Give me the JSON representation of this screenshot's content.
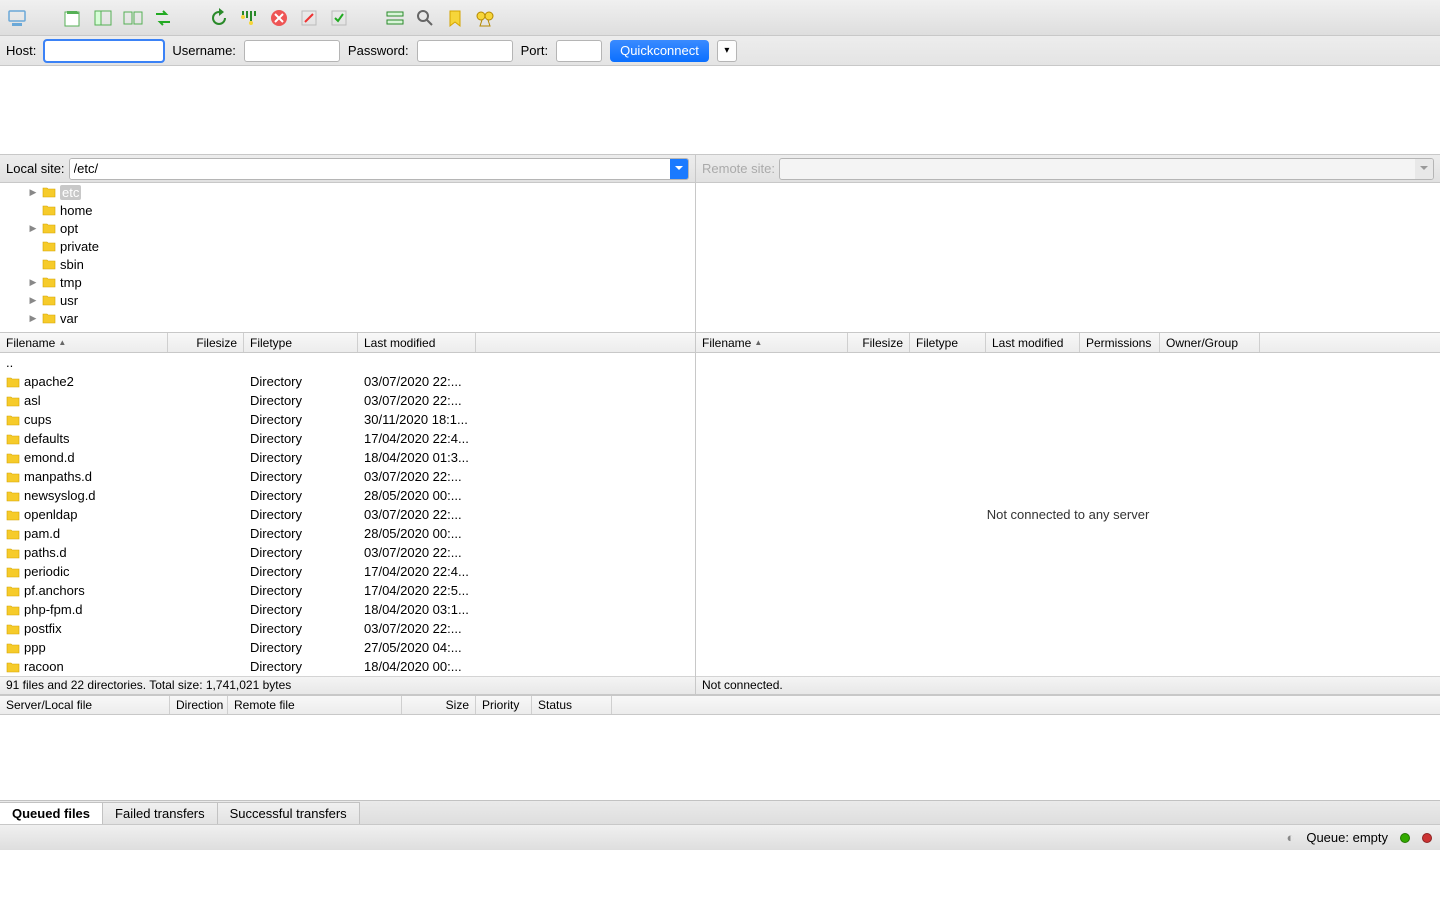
{
  "toolbar_icons": [
    "sitemanager",
    "divider",
    "new-tab",
    "toggle-tree",
    "sync-browsing",
    "transfer-arrows",
    "divider",
    "refresh",
    "filters",
    "cancel",
    "disconnect",
    "reconnect",
    "divider",
    "queue-process",
    "search-remote",
    "bookmarks",
    "find"
  ],
  "connectbar": {
    "host_label": "Host:",
    "username_label": "Username:",
    "password_label": "Password:",
    "port_label": "Port:",
    "quick_label": "Quickconnect",
    "host_value": "",
    "username_value": "",
    "password_value": "",
    "port_value": ""
  },
  "local": {
    "label": "Local site:",
    "path": "/etc/",
    "tree": [
      {
        "name": "etc",
        "selected": true,
        "expander": true
      },
      {
        "name": "home",
        "selected": false,
        "expander": false
      },
      {
        "name": "opt",
        "selected": false,
        "expander": true
      },
      {
        "name": "private",
        "selected": false,
        "expander": false
      },
      {
        "name": "sbin",
        "selected": false,
        "expander": false
      },
      {
        "name": "tmp",
        "selected": false,
        "expander": true
      },
      {
        "name": "usr",
        "selected": false,
        "expander": true
      },
      {
        "name": "var",
        "selected": false,
        "expander": true
      }
    ],
    "columns": [
      "Filename",
      "Filesize",
      "Filetype",
      "Last modified"
    ],
    "files": [
      {
        "name": "..",
        "type": "",
        "mod": ""
      },
      {
        "name": "apache2",
        "type": "Directory",
        "mod": "03/07/2020 22:..."
      },
      {
        "name": "asl",
        "type": "Directory",
        "mod": "03/07/2020 22:..."
      },
      {
        "name": "cups",
        "type": "Directory",
        "mod": "30/11/2020 18:1..."
      },
      {
        "name": "defaults",
        "type": "Directory",
        "mod": "17/04/2020 22:4..."
      },
      {
        "name": "emond.d",
        "type": "Directory",
        "mod": "18/04/2020 01:3..."
      },
      {
        "name": "manpaths.d",
        "type": "Directory",
        "mod": "03/07/2020 22:..."
      },
      {
        "name": "newsyslog.d",
        "type": "Directory",
        "mod": "28/05/2020 00:..."
      },
      {
        "name": "openldap",
        "type": "Directory",
        "mod": "03/07/2020 22:..."
      },
      {
        "name": "pam.d",
        "type": "Directory",
        "mod": "28/05/2020 00:..."
      },
      {
        "name": "paths.d",
        "type": "Directory",
        "mod": "03/07/2020 22:..."
      },
      {
        "name": "periodic",
        "type": "Directory",
        "mod": "17/04/2020 22:4..."
      },
      {
        "name": "pf.anchors",
        "type": "Directory",
        "mod": "17/04/2020 22:5..."
      },
      {
        "name": "php-fpm.d",
        "type": "Directory",
        "mod": "18/04/2020 03:1..."
      },
      {
        "name": "postfix",
        "type": "Directory",
        "mod": "03/07/2020 22:..."
      },
      {
        "name": "ppp",
        "type": "Directory",
        "mod": "27/05/2020 04:..."
      },
      {
        "name": "racoon",
        "type": "Directory",
        "mod": "18/04/2020 00:..."
      }
    ],
    "status": "91 files and 22 directories. Total size: 1,741,021 bytes"
  },
  "remote": {
    "label": "Remote site:",
    "path": "",
    "columns": [
      "Filename",
      "Filesize",
      "Filetype",
      "Last modified",
      "Permissions",
      "Owner/Group"
    ],
    "not_connected_msg": "Not connected to any server",
    "status": "Not connected."
  },
  "queue": {
    "columns": [
      "Server/Local file",
      "Direction",
      "Remote file",
      "Size",
      "Priority",
      "Status"
    ]
  },
  "tabs": {
    "queued": "Queued files",
    "failed": "Failed transfers",
    "successful": "Successful transfers"
  },
  "statusbar": {
    "queue": "Queue: empty"
  }
}
